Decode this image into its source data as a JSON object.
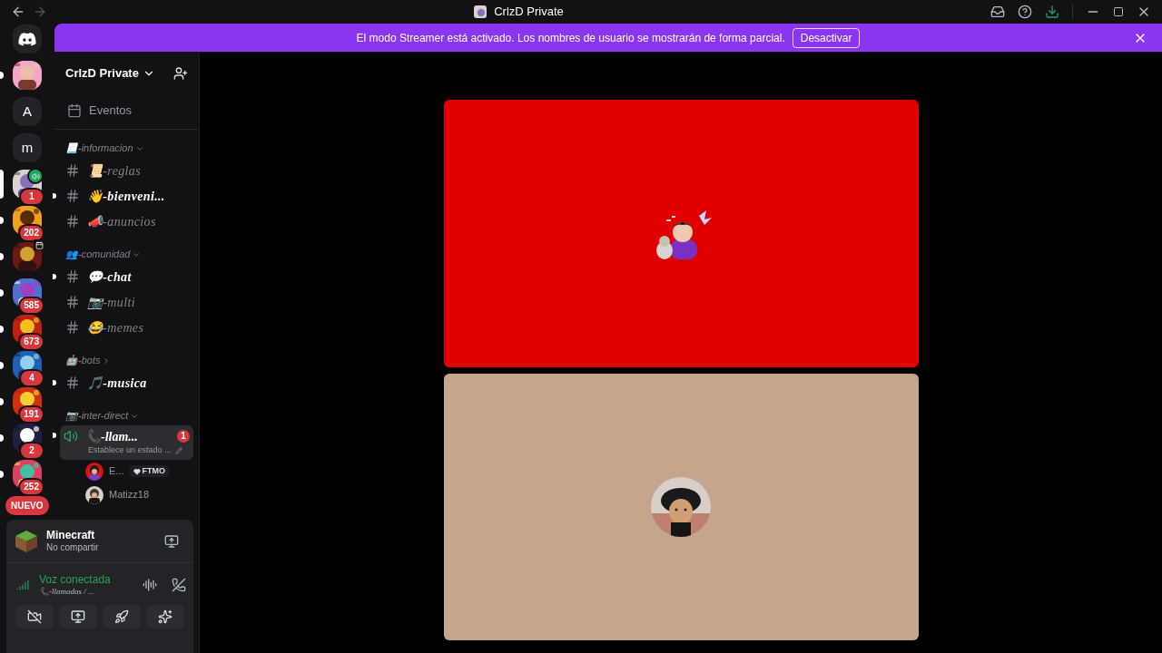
{
  "window": {
    "title": "CrlzD Private"
  },
  "servers": [
    {
      "kind": "picture",
      "unread": true,
      "selected": false,
      "voice": false,
      "event": false
    },
    {
      "kind": "letter",
      "label": "A",
      "unread": false,
      "selected": false,
      "voice": false,
      "event": false
    },
    {
      "kind": "letter",
      "label": "m",
      "unread": false,
      "selected": false,
      "voice": false,
      "event": false
    },
    {
      "kind": "picture",
      "unread": false,
      "selected": true,
      "voice": true,
      "event": false,
      "badge": "1"
    },
    {
      "kind": "picture",
      "unread": true,
      "selected": false,
      "voice": false,
      "event": false,
      "badge": "202"
    },
    {
      "kind": "picture",
      "unread": true,
      "selected": false,
      "voice": false,
      "event": true
    },
    {
      "kind": "picture",
      "unread": true,
      "selected": false,
      "voice": false,
      "event": false,
      "badge": "585"
    },
    {
      "kind": "picture",
      "unread": true,
      "selected": false,
      "voice": false,
      "event": false,
      "badge": "673"
    },
    {
      "kind": "picture",
      "unread": true,
      "selected": false,
      "voice": false,
      "event": false,
      "badge": "4"
    },
    {
      "kind": "picture",
      "unread": true,
      "selected": false,
      "voice": false,
      "event": false,
      "badge": "191"
    },
    {
      "kind": "picture",
      "unread": true,
      "selected": false,
      "voice": false,
      "event": false,
      "badge": "2"
    },
    {
      "kind": "picture",
      "unread": true,
      "selected": false,
      "voice": false,
      "event": false,
      "badge": "252"
    }
  ],
  "new_pill": "NUEVO",
  "banner": {
    "text": "El modo Streamer está activado. Los nombres de usuario se mostrarán de forma parcial.",
    "button": "Desactivar"
  },
  "server_name": "CrlzD Private",
  "events": "Eventos",
  "channels": [
    {
      "kind": "category",
      "label": "📃-informacion",
      "expanded": true
    },
    {
      "kind": "text",
      "name": "📜-reglas",
      "unread": false
    },
    {
      "kind": "text",
      "name": "👋-bienveni...",
      "unread": true
    },
    {
      "kind": "text",
      "name": "📣-anuncios",
      "unread": false
    },
    {
      "kind": "category",
      "label": "👥-comunidad",
      "expanded": true
    },
    {
      "kind": "text",
      "name": "💬-chat",
      "unread": true
    },
    {
      "kind": "text",
      "name": "📷-multi",
      "unread": false
    },
    {
      "kind": "text",
      "name": "😂-memes",
      "unread": false
    },
    {
      "kind": "category",
      "label": "🤖-bots",
      "expanded": false
    },
    {
      "kind": "text",
      "name": "🎵-musica",
      "unread": true
    },
    {
      "kind": "category",
      "label": "📷-inter-direct",
      "expanded": true
    },
    {
      "kind": "voice",
      "name": "📞-llam...",
      "status": "Establece un estado ...",
      "badge": "1",
      "selected": true,
      "unread": true,
      "members": [
        {
          "name": "E...",
          "tag": "FTMO"
        },
        {
          "name": "Matizz18"
        }
      ]
    }
  ],
  "activity": {
    "title": "Minecraft",
    "subtitle": "No compartir"
  },
  "voice_status": {
    "title": "Voz conectada",
    "channel": "📞-llamadas / ..."
  }
}
